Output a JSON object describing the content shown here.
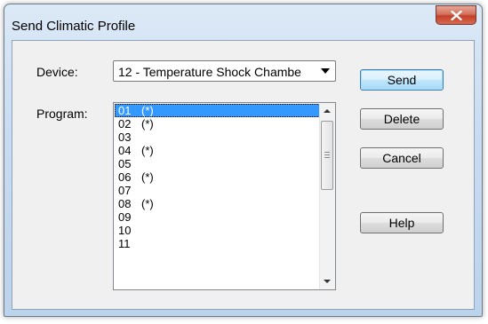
{
  "window": {
    "title": "Send Climatic Profile"
  },
  "device": {
    "label": "Device:",
    "selected": "12 - Temperature Shock Chambe"
  },
  "program": {
    "label": "Program:",
    "items": [
      {
        "code": "01",
        "mark": "(*)",
        "selected": true
      },
      {
        "code": "02",
        "mark": "(*)",
        "selected": false
      },
      {
        "code": "03",
        "mark": "",
        "selected": false
      },
      {
        "code": "04",
        "mark": "(*)",
        "selected": false
      },
      {
        "code": "05",
        "mark": "",
        "selected": false
      },
      {
        "code": "06",
        "mark": "(*)",
        "selected": false
      },
      {
        "code": "07",
        "mark": "",
        "selected": false
      },
      {
        "code": "08",
        "mark": "(*)",
        "selected": false
      },
      {
        "code": "09",
        "mark": "",
        "selected": false
      },
      {
        "code": "10",
        "mark": "",
        "selected": false
      },
      {
        "code": "11",
        "mark": "",
        "selected": false
      }
    ]
  },
  "buttons": {
    "send": "Send",
    "delete": "Delete",
    "cancel": "Cancel",
    "help": "Help"
  },
  "icons": {
    "close": "close-icon",
    "dropdown": "chevron-down-icon",
    "scroll_up": "arrow-up-icon",
    "scroll_down": "arrow-down-icon"
  },
  "colors": {
    "selection": "#3399ff",
    "close_button": "#c2402a",
    "default_button": "#3c7fb1"
  }
}
